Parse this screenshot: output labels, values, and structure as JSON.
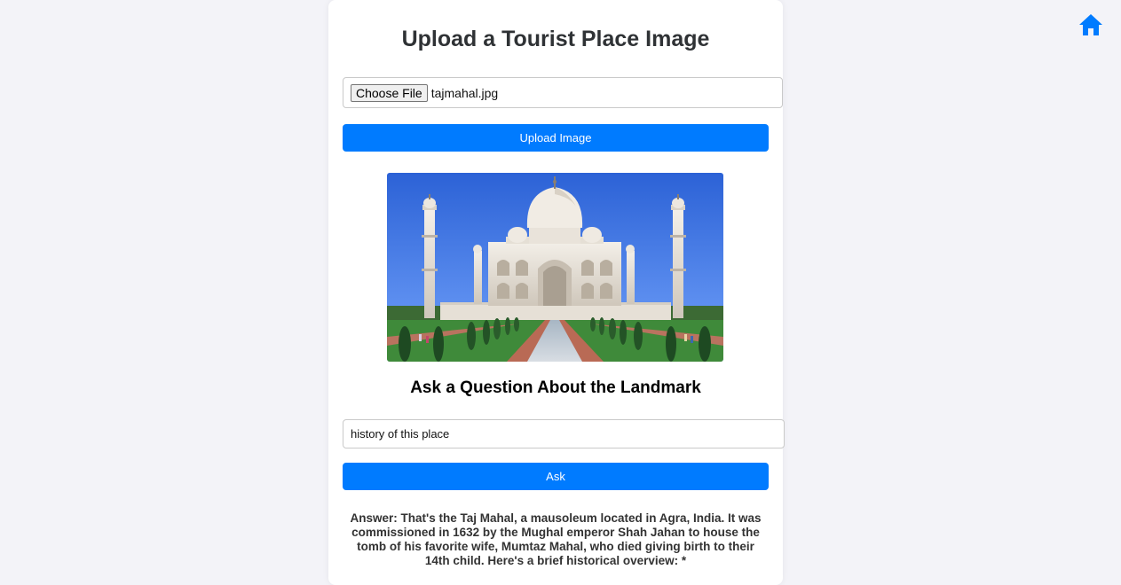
{
  "header": {
    "home_icon": "home-icon",
    "accent_color": "#007bff"
  },
  "upload": {
    "title": "Upload a Tourist Place Image",
    "choose_file_label": "Choose File",
    "file_name": "tajmahal.jpg",
    "upload_button_label": "Upload Image"
  },
  "image": {
    "alt": "Taj Mahal"
  },
  "question": {
    "heading": "Ask a Question About the Landmark",
    "input_value": "history of this place",
    "ask_button_label": "Ask"
  },
  "answer": {
    "text": "Answer: That's the Taj Mahal, a mausoleum located in Agra, India. It was commissioned in 1632 by the Mughal emperor Shah Jahan to house the tomb of his favorite wife, Mumtaz Mahal, who died giving birth to their 14th child. Here's a brief historical overview: *"
  }
}
